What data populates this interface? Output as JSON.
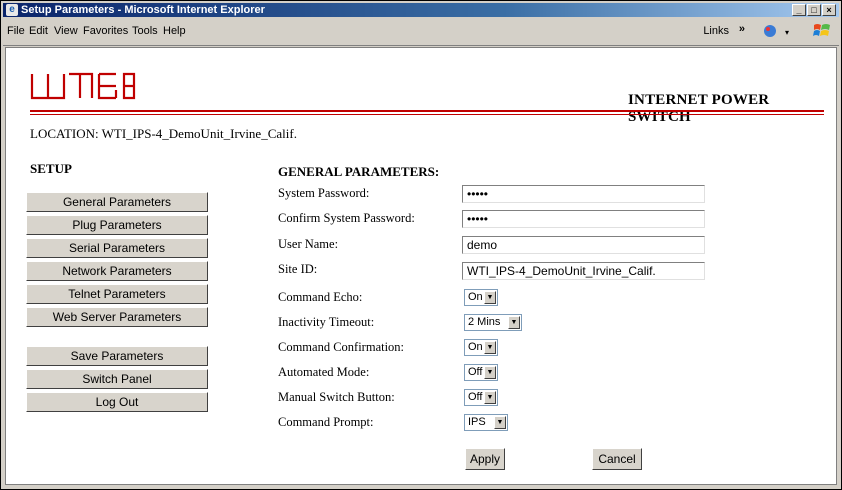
{
  "window": {
    "title": "Setup Parameters - Microsoft Internet Explorer",
    "controls": {
      "minimize": "_",
      "maximize": "□",
      "close": "×"
    }
  },
  "menubar": {
    "items": [
      "File",
      "Edit",
      "View",
      "Favorites",
      "Tools",
      "Help"
    ],
    "links_label": "Links",
    "chevron": "»"
  },
  "page": {
    "product_title": "INTERNET POWER SWITCH",
    "location_label": "LOCATION:",
    "location_value": "WTI_IPS-4_DemoUnit_Irvine_Calif.",
    "setup_heading": "SETUP",
    "section_heading": "GENERAL PARAMETERS:",
    "brand_color": "#c00000"
  },
  "nav": {
    "items": [
      "General Parameters",
      "Plug Parameters",
      "Serial Parameters",
      "Network Parameters",
      "Telnet Parameters",
      "Web Server Parameters"
    ],
    "actions": [
      "Save Parameters",
      "Switch Panel",
      "Log Out"
    ]
  },
  "form": {
    "system_password_label": "System Password:",
    "system_password_value": "•••••",
    "confirm_password_label": "Confirm System Password:",
    "confirm_password_value": "•••••",
    "user_name_label": "User Name:",
    "user_name_value": "demo",
    "site_id_label": "Site ID:",
    "site_id_value": "WTI_IPS-4_DemoUnit_Irvine_Calif.",
    "command_echo_label": "Command Echo:",
    "command_echo_value": "On",
    "inactivity_timeout_label": "Inactivity Timeout:",
    "inactivity_timeout_value": "2 Mins",
    "command_confirmation_label": "Command Confirmation:",
    "command_confirmation_value": "On",
    "automated_mode_label": "Automated Mode:",
    "automated_mode_value": "Off",
    "manual_switch_label": "Manual Switch Button:",
    "manual_switch_value": "Off",
    "command_prompt_label": "Command Prompt:",
    "command_prompt_value": "IPS",
    "apply_label": "Apply",
    "cancel_label": "Cancel"
  }
}
